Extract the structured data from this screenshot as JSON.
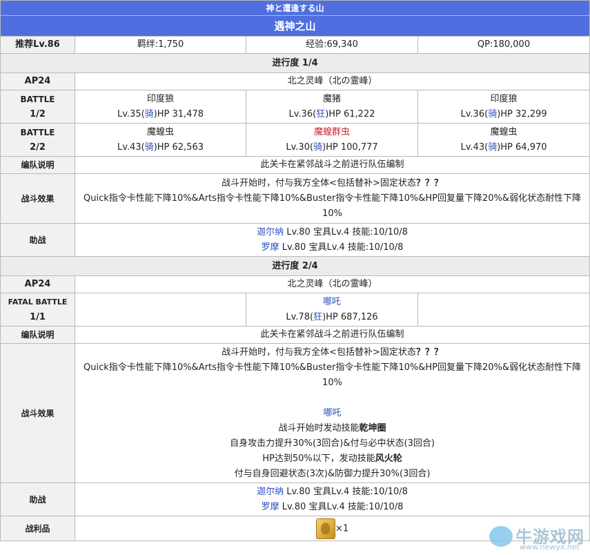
{
  "header": {
    "subtitle": "神と遭逢する山",
    "title": "遇神之山"
  },
  "info": {
    "level": "推荐Lv.86",
    "bond": "羁绊:1,750",
    "exp": "经验:69,340",
    "qp": "QP:180,000"
  },
  "progress1": {
    "label": "进行度 1/4",
    "ap": "AP24",
    "location": "北之灵峰（北の霊峰）",
    "battle1": {
      "label1": "BATTLE",
      "label2": "1/2",
      "enemies": [
        {
          "name": "印度狼",
          "pre": "Lv.35(",
          "cls": "骑",
          "post": ")HP 31,478"
        },
        {
          "name": "魔猪",
          "pre": "Lv.36(",
          "cls": "狂",
          "post": ")HP 61,222"
        },
        {
          "name": "印度狼",
          "pre": "Lv.36(",
          "cls": "骑",
          "post": ")HP 32,299"
        }
      ]
    },
    "battle2": {
      "label1": "BATTLE",
      "label2": "2/2",
      "enemies": [
        {
          "name": "魔蝗虫",
          "pre": "Lv.43(",
          "cls": "骑",
          "post": ")HP 62,563"
        },
        {
          "name": "魔蝗群虫",
          "pre": "Lv.30(",
          "cls": "骑",
          "post": ")HP 100,777"
        },
        {
          "name": "魔蝗虫",
          "pre": "Lv.43(",
          "cls": "骑",
          "post": ")HP 64,970"
        }
      ]
    },
    "formation": {
      "label": "编队说明",
      "text": "此关卡在紧邻战斗之前进行队伍编制"
    },
    "effect": {
      "label": "战斗效果",
      "line1": "战斗开始时，付与我方全体<包括替补>固定状态",
      "q": "？？？",
      "line2": "Quick指令卡性能下降10%&Arts指令卡性能下降10%&Buster指令卡性能下降10%&HP回复量下降20%&弱化状态耐性下降10%"
    },
    "support": {
      "label": "助战",
      "rows": [
        {
          "name": "迦尔纳",
          "detail": " Lv.80 宝具Lv.4 技能:10/10/8"
        },
        {
          "name": "罗摩",
          "detail": " Lv.80 宝具Lv.4 技能:10/10/8"
        }
      ]
    }
  },
  "progress2": {
    "label": "进行度 2/4",
    "ap": "AP24",
    "location": "北之灵峰（北の霊峰）",
    "battle": {
      "label1": "FATAL BATTLE",
      "label2": "1/1",
      "enemy": {
        "name": "哪吒",
        "pre": "Lv.78(",
        "cls": "狂",
        "post": ")HP 687,126"
      }
    },
    "formation": {
      "label": "编队说明",
      "text": "此关卡在紧邻战斗之前进行队伍编制"
    },
    "effect": {
      "label": "战斗效果",
      "line1": "战斗开始时，付与我方全体<包括替补>固定状态",
      "q": "？？？",
      "line2": "Quick指令卡性能下降10%&Arts指令卡性能下降10%&Buster指令卡性能下降10%&HP回复量下降20%&弱化状态耐性下降10%",
      "boss_name": "哪吒",
      "skill1_pre": "战斗开始时发动技能",
      "skill1_name": "乾坤圈",
      "skill1_desc": "自身攻击力提升30%(3回合)&付与必中状态(3回合)",
      "skill2_pre": "HP达到50%以下，发动技能",
      "skill2_name": "风火轮",
      "skill2_desc": "付与自身回避状态(3次)&防御力提升30%(3回合)"
    },
    "support": {
      "label": "助战",
      "rows": [
        {
          "name": "迦尔纳",
          "detail": " Lv.80 宝具Lv.4 技能:10/10/8"
        },
        {
          "name": "罗摩",
          "detail": " Lv.80 宝具Lv.4 技能:10/10/8"
        }
      ]
    },
    "drops": {
      "label": "战利品",
      "count": "×1",
      "icon": "gold-item-icon"
    }
  },
  "watermark": {
    "name": "牛游戏网",
    "url": "www.newyx.net"
  },
  "colors": {
    "header": "#4f6fe0",
    "link": "#2a4ec2",
    "highlight": "#d0222d"
  }
}
